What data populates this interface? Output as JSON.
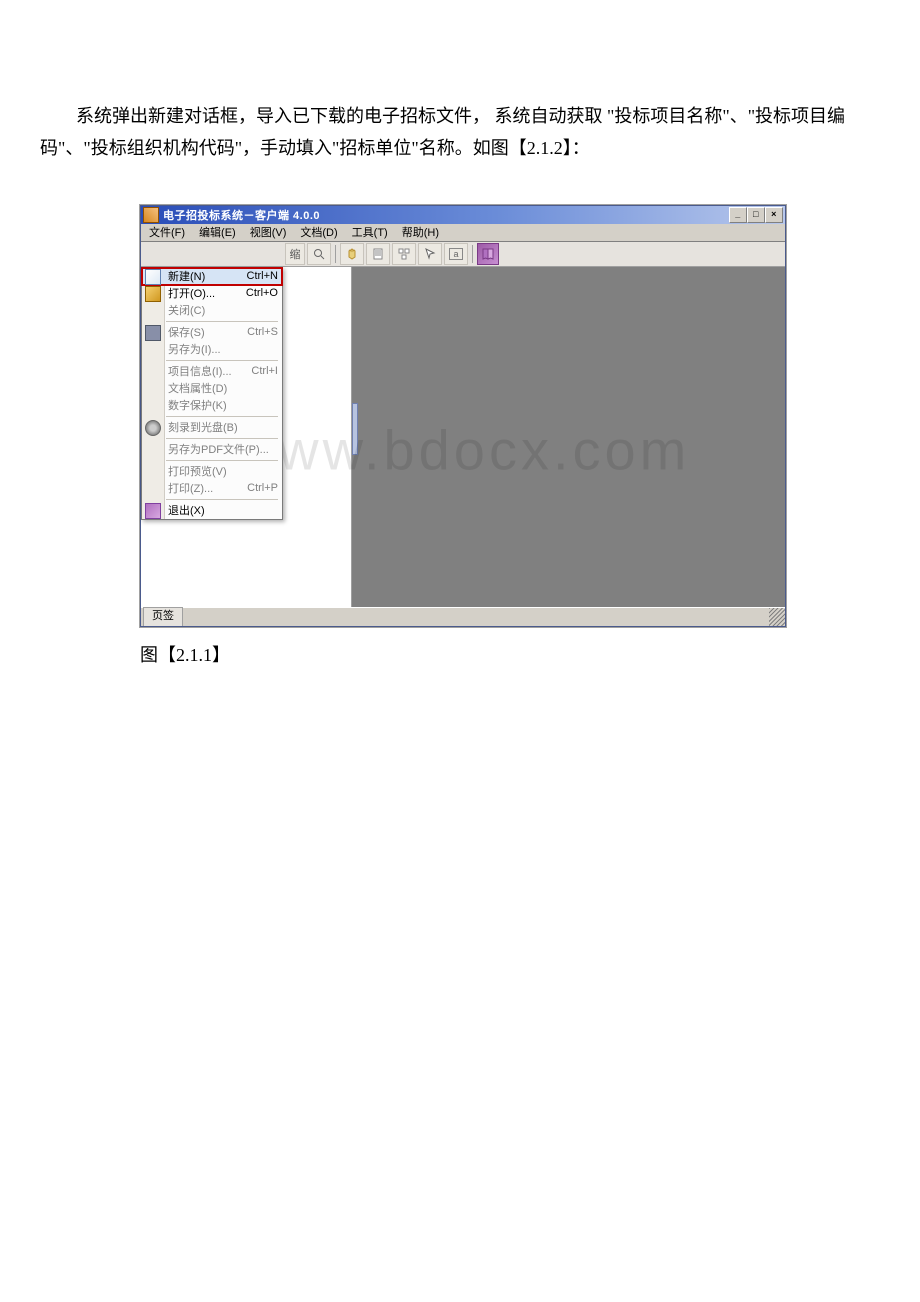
{
  "paragraph": "系统弹出新建对话框，导入已下载的电子招标文件， 系统自动获取 \"投标项目名称\"、\"投标项目编码\"、\"投标组织机构代码\"，手动填入\"招标单位\"名称。如图【2.1.2】：",
  "caption": "图【2.1.1】",
  "watermark": "www.bdocx.com",
  "screenshot": {
    "window_title": "电子招投标系统－客户端 4.0.0",
    "menubar": [
      "文件(F)",
      "编辑(E)",
      "视图(V)",
      "文档(D)",
      "工具(T)",
      "帮助(H)"
    ],
    "toolbar": {
      "reduce": "缩",
      "zoom": "Q",
      "hand": "✋",
      "page": "▦",
      "organize": "⛶",
      "grid": "▨",
      "text": "a"
    },
    "file_menu": [
      {
        "label": "新建(N)",
        "shortcut": "Ctrl+N",
        "enabled": true,
        "highlight": true,
        "icon": "ic-new"
      },
      {
        "label": "打开(O)...",
        "shortcut": "Ctrl+O",
        "enabled": true,
        "highlight": false,
        "icon": "ic-open"
      },
      {
        "label": "关闭(C)",
        "shortcut": "",
        "enabled": false,
        "highlight": false,
        "icon": "ic-close"
      },
      {
        "sep": true
      },
      {
        "label": "保存(S)",
        "shortcut": "Ctrl+S",
        "enabled": false,
        "highlight": false,
        "icon": "ic-save"
      },
      {
        "label": "另存为(I)...",
        "shortcut": "",
        "enabled": false,
        "highlight": false,
        "icon": "ic-saveas"
      },
      {
        "sep": true
      },
      {
        "label": "项目信息(I)...",
        "shortcut": "Ctrl+I",
        "enabled": false,
        "highlight": false,
        "icon": "ic-proj"
      },
      {
        "label": "文档属性(D)",
        "shortcut": "",
        "enabled": false,
        "highlight": false,
        "icon": ""
      },
      {
        "label": "数字保护(K)",
        "shortcut": "",
        "enabled": false,
        "highlight": false,
        "icon": ""
      },
      {
        "sep": true
      },
      {
        "label": "刻录到光盘(B)",
        "shortcut": "",
        "enabled": false,
        "highlight": false,
        "icon": "ic-burn"
      },
      {
        "sep": true
      },
      {
        "label": "另存为PDF文件(P)...",
        "shortcut": "",
        "enabled": false,
        "highlight": false,
        "icon": ""
      },
      {
        "sep": true
      },
      {
        "label": "打印预览(V)",
        "shortcut": "",
        "enabled": false,
        "highlight": false,
        "icon": ""
      },
      {
        "label": "打印(Z)...",
        "shortcut": "Ctrl+P",
        "enabled": false,
        "highlight": false,
        "icon": ""
      },
      {
        "sep": true
      },
      {
        "label": "退出(X)",
        "shortcut": "",
        "enabled": true,
        "highlight": false,
        "icon": "ic-exit"
      }
    ],
    "status_tab": "页签",
    "win_buttons": {
      "min": "_",
      "max": "□",
      "close": "×"
    }
  }
}
